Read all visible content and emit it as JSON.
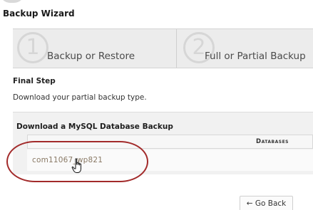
{
  "header": {
    "title": "Backup Wizard"
  },
  "steps": [
    {
      "number": "1",
      "label": "Backup or Restore"
    },
    {
      "number": "2",
      "label": "Full or Partial Backup"
    }
  ],
  "final_step": {
    "title": "Final Step",
    "description": "Download your partial backup type."
  },
  "database_panel": {
    "title": "Download a MySQL Database Backup",
    "column_header": "Databases",
    "databases": [
      "com11067_wp821"
    ]
  },
  "actions": {
    "back_label": "← Go Back"
  },
  "colors": {
    "highlight": "#a22a2a",
    "link": "#8a7a66"
  }
}
